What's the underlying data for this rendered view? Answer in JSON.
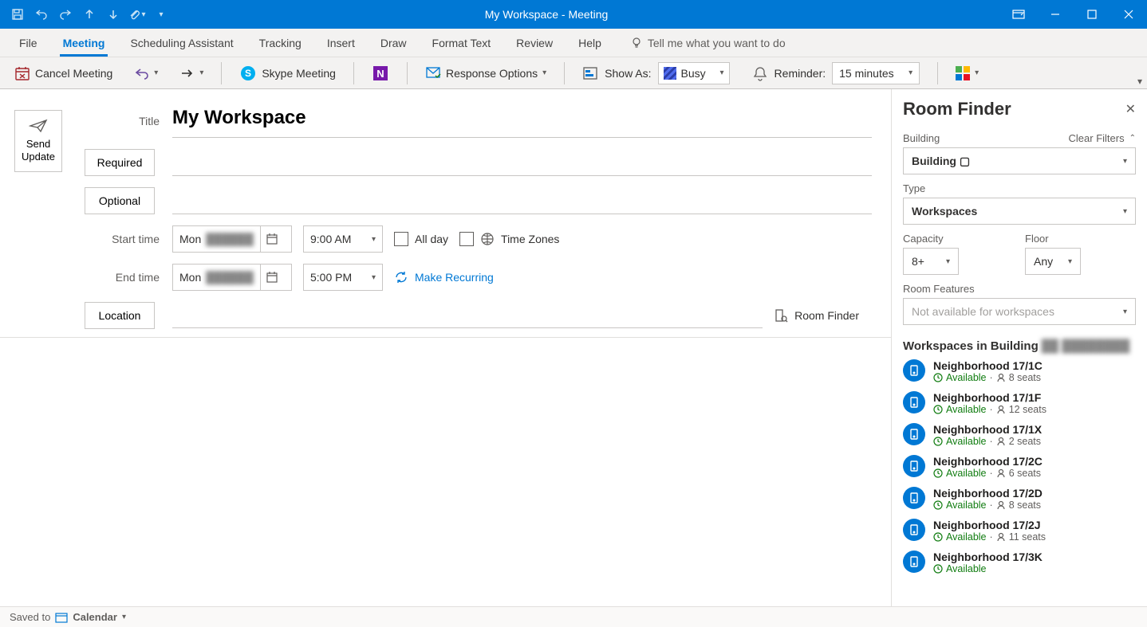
{
  "titlebar": {
    "title": "My Workspace - Meeting"
  },
  "tabs": {
    "file": "File",
    "meeting": "Meeting",
    "scheduling": "Scheduling Assistant",
    "tracking": "Tracking",
    "insert": "Insert",
    "draw": "Draw",
    "format": "Format Text",
    "review": "Review",
    "help": "Help",
    "tellme": "Tell me what you want to do"
  },
  "ribbon": {
    "cancel": "Cancel Meeting",
    "skype": "Skype Meeting",
    "response": "Response Options",
    "showas_label": "Show As:",
    "showas_value": "Busy",
    "reminder_label": "Reminder:",
    "reminder_value": "15 minutes"
  },
  "form": {
    "send": "Send Update",
    "title_label": "Title",
    "title_value": "My Workspace",
    "required": "Required",
    "optional": "Optional",
    "start_label": "Start time",
    "end_label": "End time",
    "start_date": "Mon",
    "end_date": "Mon",
    "start_time": "9:00 AM",
    "end_time": "5:00 PM",
    "allday": "All day",
    "timezones": "Time Zones",
    "recurring": "Make Recurring",
    "location_label": "Location",
    "room_finder": "Room Finder"
  },
  "pane": {
    "title": "Room Finder",
    "building_label": "Building",
    "clear_filters": "Clear Filters",
    "building_value": "Building ▢",
    "type_label": "Type",
    "type_value": "Workspaces",
    "capacity_label": "Capacity",
    "capacity_value": "8+",
    "floor_label": "Floor",
    "floor_value": "Any",
    "features_label": "Room Features",
    "features_value": "Not available for workspaces",
    "list_heading": "Workspaces in Building",
    "available": "Available",
    "items": [
      {
        "name": "Neighborhood 17/1C",
        "seats": "8 seats"
      },
      {
        "name": "Neighborhood 17/1F",
        "seats": "12 seats"
      },
      {
        "name": "Neighborhood 17/1X",
        "seats": "2 seats"
      },
      {
        "name": "Neighborhood 17/2C",
        "seats": "6 seats"
      },
      {
        "name": "Neighborhood 17/2D",
        "seats": "8 seats"
      },
      {
        "name": "Neighborhood 17/2J",
        "seats": "11 seats"
      },
      {
        "name": "Neighborhood 17/3K",
        "seats": ""
      }
    ]
  },
  "status": {
    "saved_to": "Saved to",
    "calendar": "Calendar"
  }
}
